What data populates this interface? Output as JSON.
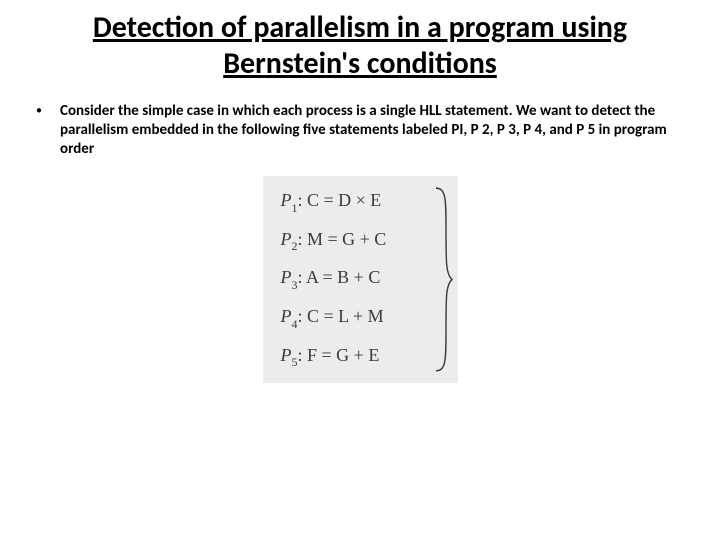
{
  "title": "Detection of parallelism in a program using Bernstein's conditions",
  "bullet_char": "•",
  "body_text": "Consider the simple case in which each process is a single HLL statement. We want to detect the parallelism embedded in the following five statements labeled PI, P 2, P 3, P 4, and P 5 in program order",
  "equations": {
    "p1": {
      "label": "P",
      "sub": "1",
      "expr": ": C = D × E"
    },
    "p2": {
      "label": "P",
      "sub": "2",
      "expr": ": M = G + C"
    },
    "p3": {
      "label": "P",
      "sub": "3",
      "expr": ": A = B + C"
    },
    "p4": {
      "label": "P",
      "sub": "4",
      "expr": ": C = L + M"
    },
    "p5": {
      "label": "P",
      "sub": "5",
      "expr": ": F = G + E"
    }
  }
}
